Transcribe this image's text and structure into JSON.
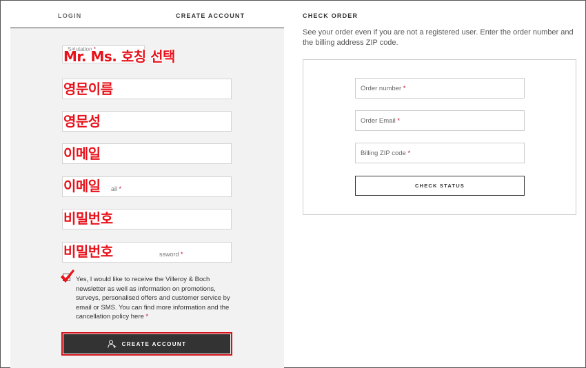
{
  "tabs": {
    "login": "LOGIN",
    "create_account": "CREATE ACCOUNT",
    "check_order": "CHECK ORDER"
  },
  "create_form": {
    "salutation_label": "Salutation",
    "salutation_overlay": "Mr. Ms. 호칭 선택",
    "first_name_overlay": "영문이름",
    "last_name_overlay": "영문성",
    "email_overlay": "이메일",
    "confirm_email_overlay": "이메일",
    "confirm_email_fragment": "ail",
    "password_overlay": "비밀번호",
    "confirm_password_overlay": "비밀번호",
    "confirm_password_fragment": "ssword",
    "required_mark": "*",
    "consent_text": "Yes, I would like to receive the Villeroy & Boch newsletter as well as information on promotions, surveys, personalised offers and customer service by email or SMS. You can find more information and the cancellation policy",
    "consent_link": "here",
    "create_button": "CREATE ACCOUNT"
  },
  "check_order": {
    "description": "See your order even if you are not a registered user. Enter the order number and the billing address ZIP code.",
    "order_number_placeholder": "Order number",
    "order_email_placeholder": "Order Email",
    "billing_zip_placeholder": "Billing ZIP code",
    "check_button": "CHECK STATUS"
  },
  "colors": {
    "accent_red": "#e8121b",
    "button_dark": "#333333",
    "panel_bg": "#f2f2f2"
  },
  "icons": {
    "create_button_icon": "add-user-icon",
    "checkbox_mark": "checkmark-icon"
  }
}
